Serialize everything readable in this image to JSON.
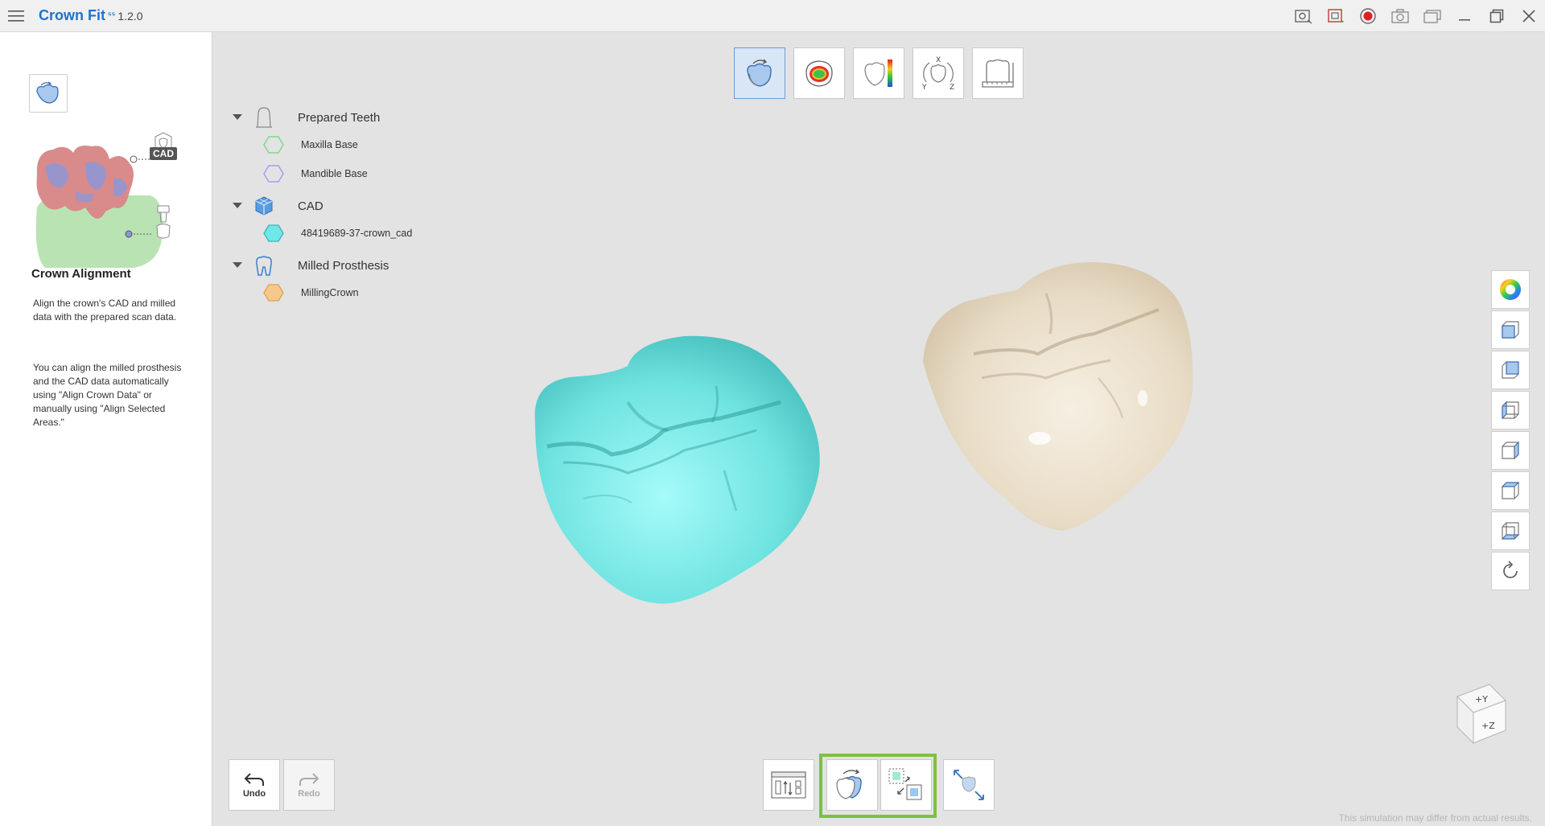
{
  "app": {
    "name": "Crown Fit",
    "superscript": "⁵⁵",
    "version": "1.2.0"
  },
  "title_tools": [
    {
      "name": "capture-icon"
    },
    {
      "name": "screen-icon"
    },
    {
      "name": "record-icon"
    },
    {
      "name": "camera-icon"
    },
    {
      "name": "window-icon"
    },
    {
      "name": "minimize-icon"
    },
    {
      "name": "restore-icon"
    },
    {
      "name": "close-icon"
    }
  ],
  "left_panel": {
    "cad_badge": "CAD",
    "title": "Crown Alignment",
    "description": "Align the crown's CAD and milled data with the prepared scan data.",
    "description2": "You can align the milled prosthesis and the CAD data automatically using \"Align Crown Data\" or manually using \"Align Selected Areas.\""
  },
  "top_toolbar": [
    {
      "name": "crown-alignment-tool",
      "active": true
    },
    {
      "name": "contact-map-tool",
      "active": false
    },
    {
      "name": "color-scale-tool",
      "active": false
    },
    {
      "name": "axis-orientation-tool",
      "active": false
    },
    {
      "name": "measure-tool",
      "active": false
    }
  ],
  "tree": {
    "groups": [
      {
        "label": "Prepared Teeth",
        "icon": "prepared-teeth-icon",
        "items": [
          {
            "label": "Maxilla Base",
            "color": "#7fd88f",
            "fill": "none"
          },
          {
            "label": "Mandible Base",
            "color": "#a89cf0",
            "fill": "none"
          }
        ]
      },
      {
        "label": "CAD",
        "icon": "cad-cube-icon",
        "items": [
          {
            "label": "48419689-37-crown_cad",
            "color": "#3fb3b8",
            "fill": "#6fe8ea"
          }
        ]
      },
      {
        "label": "Milled Prosthesis",
        "icon": "milled-prosthesis-icon",
        "items": [
          {
            "label": "MillingCrown",
            "color": "#e0a050",
            "fill": "#f5c98a"
          }
        ]
      }
    ]
  },
  "colors": {
    "cad_crown": "#6fe3e0",
    "milled_crown": "#e8dcc6",
    "highlight": "#7dc142",
    "accent": "#1f73c9"
  },
  "undo": {
    "label": "Undo"
  },
  "redo": {
    "label": "Redo"
  },
  "bottom_tools": [
    {
      "name": "data-list-tool"
    },
    {
      "name": "align-crown-data-tool"
    },
    {
      "name": "align-selected-areas-tool"
    },
    {
      "name": "expand-tool"
    }
  ],
  "orientation_cube": {
    "y": "+Y",
    "z": "+Z"
  },
  "disclaimer": "This simulation may differ from actual results."
}
